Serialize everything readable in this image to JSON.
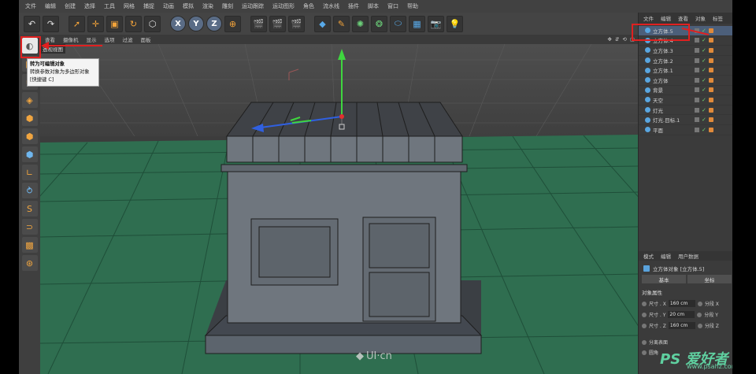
{
  "menu": [
    "文件",
    "编辑",
    "创建",
    "选择",
    "工具",
    "网格",
    "捕捉",
    "动画",
    "模拟",
    "渲染",
    "雕刻",
    "运动跟踪",
    "运动图形",
    "角色",
    "流水线",
    "插件",
    "脚本",
    "窗口",
    "帮助"
  ],
  "toolbar": {
    "undo": "↶",
    "xyz": [
      "X",
      "Y",
      "Z"
    ]
  },
  "viewport": {
    "menu": [
      "查看",
      "摄像机",
      "显示",
      "选项",
      "过滤",
      "面板"
    ],
    "label": "透视视图"
  },
  "tooltip": {
    "title": "转为可编辑对象",
    "desc": "转换参数对象为多边形对象",
    "shortcut": "[快捷键 C]"
  },
  "object_manager": {
    "tabs": [
      "文件",
      "编辑",
      "查看",
      "对象",
      "标签"
    ],
    "objects": [
      {
        "name": "立方体.5",
        "selected": true
      },
      {
        "name": "立方体.4",
        "selected": false
      },
      {
        "name": "立方体.3",
        "selected": false
      },
      {
        "name": "立方体.2",
        "selected": false
      },
      {
        "name": "立方体.1",
        "selected": false
      },
      {
        "name": "立方体",
        "selected": false
      },
      {
        "name": "背景",
        "selected": false
      },
      {
        "name": "天空",
        "selected": false
      },
      {
        "name": "灯光",
        "selected": false
      },
      {
        "name": "灯光.目标.1",
        "selected": false
      },
      {
        "name": "平面",
        "selected": false
      }
    ]
  },
  "attributes": {
    "tabs": [
      "模式",
      "编辑",
      "用户数据"
    ],
    "title": "立方体对象 [立方体.5]",
    "buttons": [
      "基本",
      "坐标"
    ],
    "section": "对象属性",
    "rows": [
      {
        "label": "尺寸 . X",
        "value": "160 cm",
        "seg": "分段 X"
      },
      {
        "label": "尺寸 . Y",
        "value": "20 cm",
        "seg": "分段 Y"
      },
      {
        "label": "尺寸 . Z",
        "value": "160 cm",
        "seg": "分段 Z"
      }
    ],
    "extra": [
      "分离表面",
      "圆角"
    ]
  },
  "watermark": "UI·cn",
  "ps_watermark": "PS 爱好者",
  "ps_url": "www.psahz.com",
  "colors": {
    "selection": "#4c5f7a",
    "grid": "#2e6b4f",
    "highlight": "#e02020"
  }
}
